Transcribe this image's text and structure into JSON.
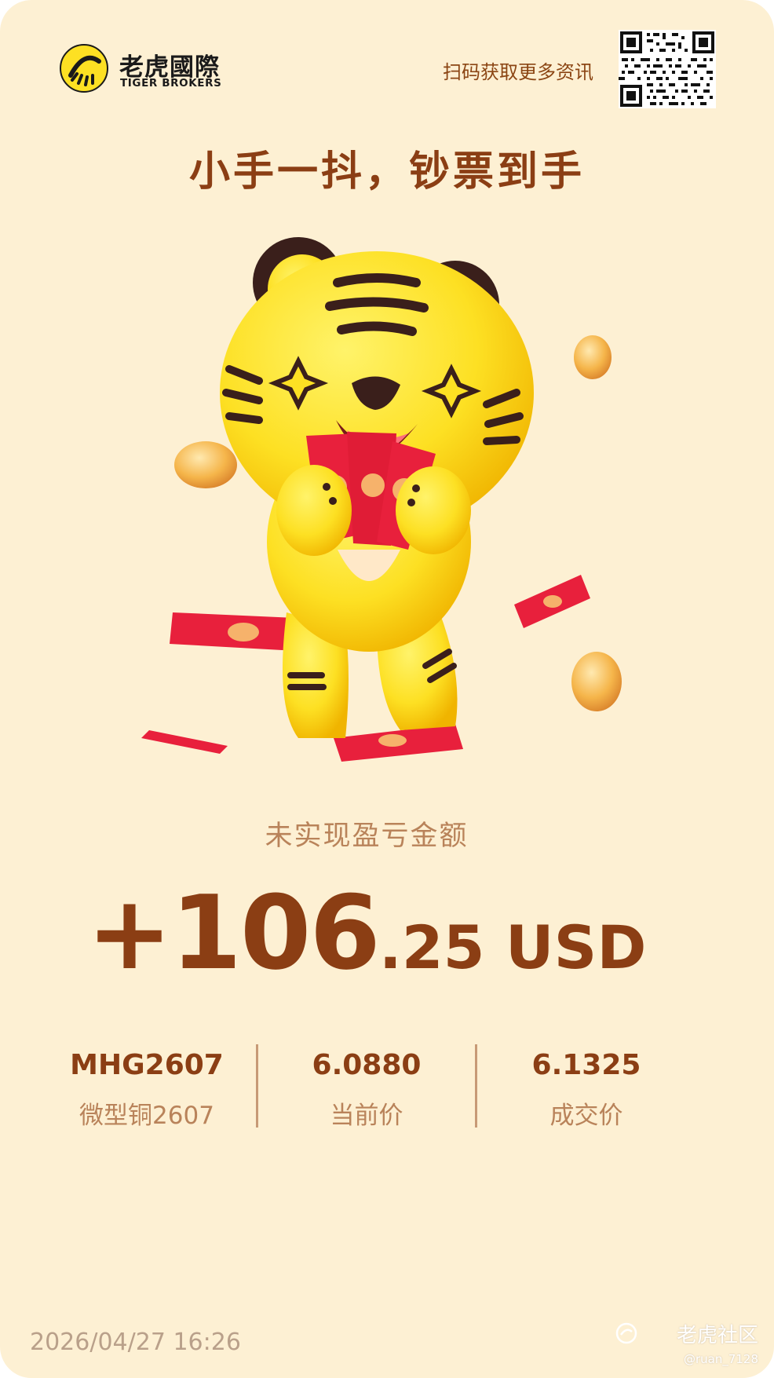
{
  "header": {
    "logo_cn": "老虎國際",
    "logo_en": "TIGER BROKERS",
    "qr_hint": "扫码获取更多资讯"
  },
  "headline": "小手一抖，钞票到手",
  "hero": {
    "illustration": "tiger-mascot-holding-red-envelopes"
  },
  "pnl": {
    "label": "未实现盈亏金额",
    "sign_integer": "+106",
    "decimals": ".25",
    "currency": " USD"
  },
  "stats": [
    {
      "value": "MHG2607",
      "label": "微型铜2607"
    },
    {
      "value": "6.0880",
      "label": "当前价"
    },
    {
      "value": "6.1325",
      "label": "成交价"
    }
  ],
  "footer": {
    "timestamp": "2026/04/27 16:26",
    "watermark": "老虎社区",
    "watermark_user": "@ruan_7128"
  },
  "colors": {
    "background": "#fdf0d3",
    "accent": "#8b3e14",
    "muted": "#b9835a",
    "tiger_yellow": "#fde023",
    "envelope_red": "#e8203c"
  }
}
